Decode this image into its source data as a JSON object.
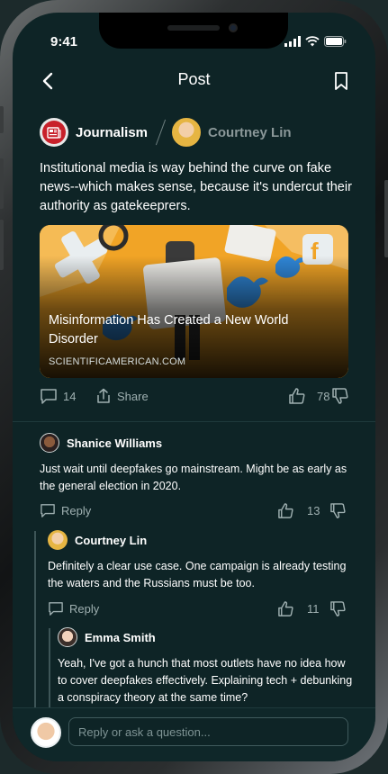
{
  "status_bar": {
    "time": "9:41"
  },
  "nav": {
    "title": "Post"
  },
  "post": {
    "publication": "Journalism",
    "author": "Courtney Lin",
    "text": "Institutional media is way behind the curve on fake news--which makes sense, because it's undercut their authority as gatekeeprers.",
    "link": {
      "title": "Misinformation Has Created a New World Disorder",
      "source": "SCIENTIFICAMERICAN.COM"
    },
    "comment_count": "14",
    "share_label": "Share",
    "like_count": "78"
  },
  "comments": [
    {
      "name": "Shanice Williams",
      "text": "Just wait until deepfakes go mainstream. Might be as early as the general election in 2020.",
      "reply_label": "Reply",
      "likes": "13"
    },
    {
      "name": "Courtney Lin",
      "text": "Definitely a clear use case. One campaign is already testing the waters and the Russians must be too.",
      "reply_label": "Reply",
      "likes": "11"
    },
    {
      "name": "Emma Smith",
      "text": "Yeah, I've got a hunch that most outlets have no idea how to cover deepfakes effectively. Explaining tech + debunking a conspiracy theory at the same time?"
    }
  ],
  "compose": {
    "placeholder": "Reply or ask a question..."
  },
  "colors": {
    "background": "#0e2426",
    "accent": "#f1a426",
    "brand_red": "#c8202a"
  },
  "icons": [
    "back-icon",
    "bookmark-icon",
    "comment-icon",
    "share-icon",
    "thumbs-up-icon",
    "thumbs-down-icon",
    "signal-icon",
    "wifi-icon",
    "battery-icon"
  ]
}
